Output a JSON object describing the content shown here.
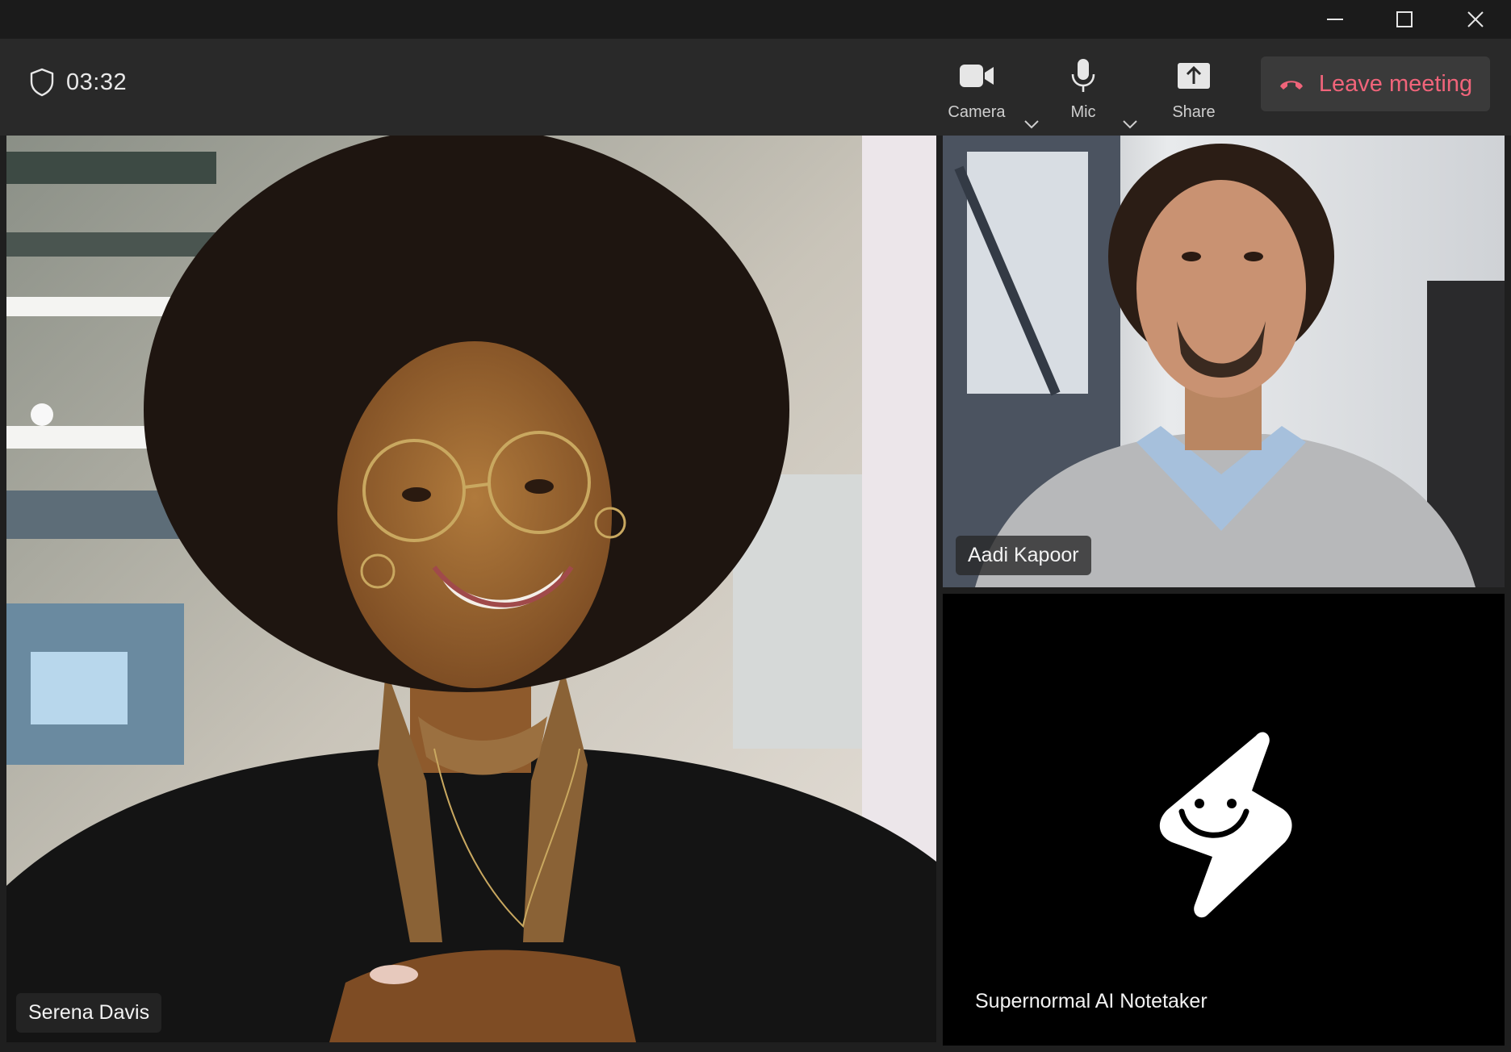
{
  "window_controls": {
    "minimize_icon": "minimize-icon",
    "maximize_icon": "maximize-icon",
    "close_icon": "close-icon"
  },
  "toolbar": {
    "timer": "03:32",
    "camera_label": "Camera",
    "mic_label": "Mic",
    "share_label": "Share",
    "leave_label": "Leave meeting",
    "leave_color": "#f0647a"
  },
  "participants": [
    {
      "name": "Serena Davis"
    },
    {
      "name": "Aadi Kapoor"
    },
    {
      "name": "Supernormal AI Notetaker"
    }
  ]
}
